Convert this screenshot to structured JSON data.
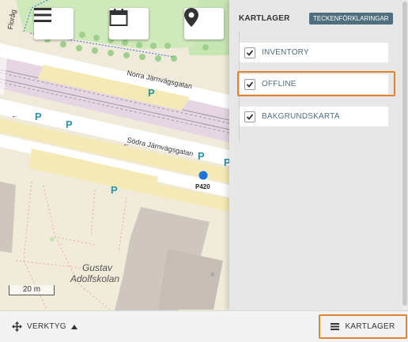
{
  "map": {
    "controls": [
      {
        "icon": "menu-icon"
      },
      {
        "icon": "calendar-icon"
      },
      {
        "icon": "location-pin-icon"
      }
    ],
    "street_labels": {
      "norra": "Norra Järnvägsgatan",
      "sodra": "Södra Järnvägsgatan",
      "edge": "Floråg"
    },
    "parking_label": "P",
    "marker_label": "P420",
    "place_label_line1": "Gustav",
    "place_label_line2": "Adolfskolan",
    "building_number": "8",
    "scale": "20 m",
    "colors": {
      "road": "#ffffff",
      "park": "#c8e6b3",
      "rail": "#e6d6e3",
      "marker": "#1a73d9",
      "parking_text": "#2b93a6"
    }
  },
  "panel": {
    "title": "KARTLAGER",
    "legend_button": "TECKENFÖRKLARINGAR",
    "layers": [
      {
        "label": "INVENTORY",
        "checked": true
      },
      {
        "label": "OFFLINE",
        "checked": true,
        "highlighted": true
      },
      {
        "label": "BAKGRUNDSKARTA",
        "checked": true
      }
    ]
  },
  "toolbar": {
    "tools_label": "VERKTYG",
    "layers_label": "KARTLAGER"
  },
  "colors": {
    "accent_highlight": "#e0842e",
    "label_text": "#4f6e7e",
    "legend_bg": "#4f6e7e"
  }
}
